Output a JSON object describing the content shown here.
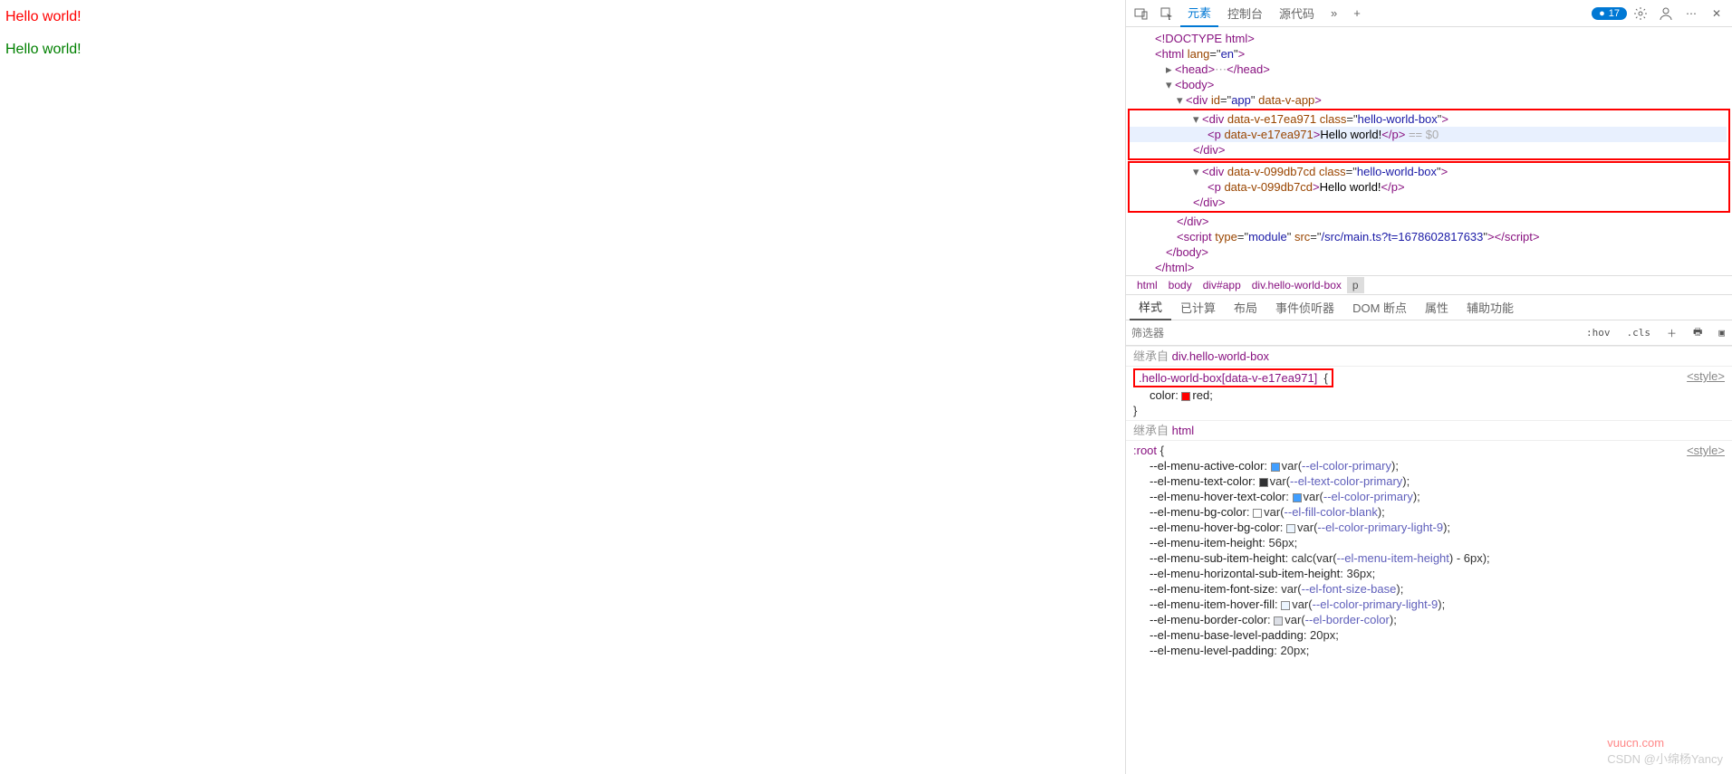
{
  "page": {
    "text1": "Hello world!",
    "text2": "Hello world!"
  },
  "toolbar": {
    "tabs": [
      "元素",
      "控制台",
      "源代码"
    ],
    "more_icon": "»",
    "plus_icon": "+",
    "issues_count": "17"
  },
  "dom": {
    "doctype": "<!DOCTYPE html>",
    "html_open": "html",
    "html_lang_attr": "lang",
    "html_lang_val": "en",
    "head": "head",
    "body": "body",
    "app_div": "div",
    "app_id_attr": "id",
    "app_id_val": "app",
    "app_data_attr": "data-v-app",
    "box1_div": "div",
    "box1_data_attr": "data-v-e17ea971",
    "box1_class_attr": "class",
    "box1_class_val": "hello-world-box",
    "box1_p": "p",
    "box1_p_data": "data-v-e17ea971",
    "box1_text": "Hello world!",
    "box1_hint": "== $0",
    "box2_div": "div",
    "box2_data_attr": "data-v-099db7cd",
    "box2_class_attr": "class",
    "box2_class_val": "hello-world-box",
    "box2_p": "p",
    "box2_p_data": "data-v-099db7cd",
    "box2_text": "Hello world!",
    "script_tag": "script",
    "script_type_attr": "type",
    "script_type_val": "module",
    "script_src_attr": "src",
    "script_src_val": "/src/main.ts?t=1678602817633"
  },
  "crumbs": [
    "html",
    "body",
    "div#app",
    "div.hello-world-box",
    "p"
  ],
  "subtabs": [
    "样式",
    "已计算",
    "布局",
    "事件侦听器",
    "DOM 断点",
    "属性",
    "辅助功能"
  ],
  "filter": {
    "placeholder": "筛选器",
    "hov": ":hov",
    "cls": ".cls"
  },
  "styles": {
    "inherit1_label": "继承自",
    "inherit1_from": "div.hello-world-box",
    "rule1_selector": ".hello-world-box[data-v-e17ea971]",
    "rule1_brace": "{",
    "rule1_src": "<style>",
    "rule1_prop": "color",
    "rule1_val": "red",
    "rule1_close": "}",
    "inherit2_label": "继承自",
    "inherit2_from": "html",
    "root_sel": ":root",
    "root_brace": "{",
    "root_src": "<style>",
    "vars": [
      {
        "n": "--el-menu-active-color",
        "v": "var(",
        "vr": "--el-color-primary",
        "t": ");",
        "sw": "#409eff"
      },
      {
        "n": "--el-menu-text-color",
        "v": "var(",
        "vr": "--el-text-color-primary",
        "t": ");",
        "sw": "#303133"
      },
      {
        "n": "--el-menu-hover-text-color",
        "v": "var(",
        "vr": "--el-color-primary",
        "t": ");",
        "sw": "#409eff"
      },
      {
        "n": "--el-menu-bg-color",
        "v": "var(",
        "vr": "--el-fill-color-blank",
        "t": ");",
        "sw": "#ffffff"
      },
      {
        "n": "--el-menu-hover-bg-color",
        "v": "var(",
        "vr": "--el-color-primary-light-9",
        "t": ");",
        "sw": "#ecf5ff"
      },
      {
        "n": "--el-menu-item-height",
        "v": "56px;",
        "vr": "",
        "t": "",
        "sw": ""
      },
      {
        "n": "--el-menu-sub-item-height",
        "v": "calc(var(",
        "vr": "--el-menu-item-height",
        "t": ") - 6px);",
        "sw": ""
      },
      {
        "n": "--el-menu-horizontal-sub-item-height",
        "v": "36px;",
        "vr": "",
        "t": "",
        "sw": ""
      },
      {
        "n": "--el-menu-item-font-size",
        "v": "var(",
        "vr": "--el-font-size-base",
        "t": ");",
        "sw": ""
      },
      {
        "n": "--el-menu-item-hover-fill",
        "v": "var(",
        "vr": "--el-color-primary-light-9",
        "t": ");",
        "sw": "#ecf5ff"
      },
      {
        "n": "--el-menu-border-color",
        "v": "var(",
        "vr": "--el-border-color",
        "t": ");",
        "sw": "#dcdfe6"
      },
      {
        "n": "--el-menu-base-level-padding",
        "v": "20px;",
        "vr": "",
        "t": "",
        "sw": ""
      },
      {
        "n": "--el-menu-level-padding",
        "v": "20px;",
        "vr": "",
        "t": "",
        "sw": ""
      }
    ]
  },
  "watermark": {
    "site": "vuucn.com",
    "credit": "CSDN @小绵杨Yancy"
  }
}
